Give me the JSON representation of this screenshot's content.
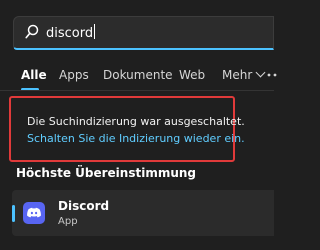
{
  "search": {
    "query": "discord"
  },
  "tabs": [
    {
      "label": "Alle",
      "active": true
    },
    {
      "label": "Apps"
    },
    {
      "label": "Dokumente"
    },
    {
      "label": "Web"
    },
    {
      "label": "Mehr"
    }
  ],
  "notice": {
    "message": "Die Suchindizierung war ausgeschaltet.",
    "link": "Schalten Sie die Indizierung wieder ein."
  },
  "best_match": {
    "heading": "Höchste Übereinstimmung",
    "app_name": "Discord",
    "app_type": "App",
    "icon": "discord-icon"
  },
  "colors": {
    "background": "#1f1f1f",
    "accent": "#4cc2ff",
    "link": "#60cdff",
    "highlight_box": "#e03a3a",
    "discord_brand": "#5865f2"
  }
}
